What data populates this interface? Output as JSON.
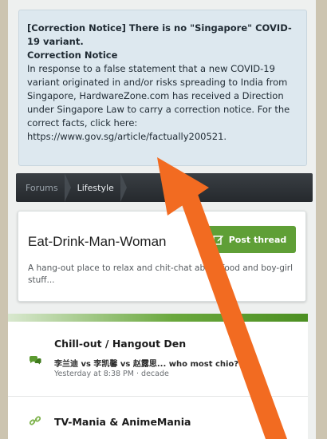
{
  "notice": {
    "title": "[Correction Notice] There is no \"Singapore\" COVID-19 variant.",
    "heading": "Correction Notice",
    "body": "In response to a false statement that a new COVID-19 variant originated in and/or risks spreading to India from Singapore, HardwareZone.com has received a Direction under Singapore Law to carry a correction notice. For the correct facts, click here:",
    "link": "https://www.gov.sg/article/factually200521."
  },
  "breadcrumb": {
    "items": [
      "Forums",
      "Lifestyle"
    ]
  },
  "forum": {
    "title": "Eat-Drink-Man-Woman",
    "post_button": "Post thread",
    "description": "A hang-out place to relax and chit-chat about food and boy-girl stuff..."
  },
  "list": [
    {
      "title": "Chill-out / Hangout Den",
      "latest": "李兰迪 vs 李凯馨 vs 赵露思... who most chio?",
      "meta": "Yesterday at 8:38 PM · decade",
      "icon": "chat-bubbles-icon"
    },
    {
      "title": "TV-Mania & AnimeMania",
      "icon": "link-icon"
    }
  ],
  "colors": {
    "accent_green": "#5f9f36",
    "arrow_orange": "#f26b21",
    "notice_bg": "#dde8ef",
    "crumb_bg": "#2f3438"
  }
}
